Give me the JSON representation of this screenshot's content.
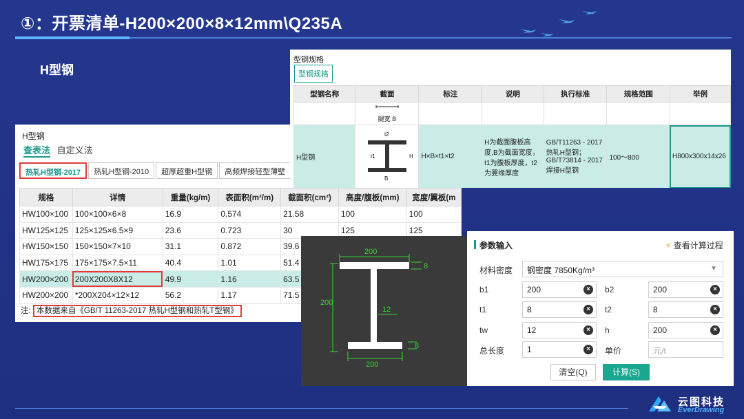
{
  "slide": {
    "title": "①：开票清单-H200×200×8×12mm\\Q235A",
    "section": "H型钢",
    "logo_cn": "云图科技",
    "logo_en": "EverDrawing"
  },
  "lookup": {
    "header": "H型钢",
    "tabs": [
      "查表法",
      "自定义法"
    ],
    "subtabs": [
      "热轧H型钢-2017",
      "热轧H型钢-2010",
      "超厚超重H型钢",
      "高频焊接轻型薄壁"
    ],
    "columns": [
      "规格",
      "详情",
      "重量(kg/m)",
      "表面积(m²/m)",
      "截面积(cm²)",
      "高度/腹板(mm)",
      "宽度/翼板(m"
    ],
    "rows": [
      [
        "HW100×100",
        "100×100×6×8",
        "16.9",
        "0.574",
        "21.58",
        "100",
        "100"
      ],
      [
        "HW125×125",
        "125×125×6.5×9",
        "23.6",
        "0.723",
        "30",
        "125",
        "125"
      ],
      [
        "HW150×150",
        "150×150×7×10",
        "31.1",
        "0.872",
        "39.6",
        "",
        ""
      ],
      [
        "HW175×175",
        "175×175×7.5×11",
        "40.4",
        "1.01",
        "51.4",
        "",
        ""
      ],
      [
        "HW200×200",
        "200X200X8X12",
        "49.9",
        "1.16",
        "63.5",
        "",
        ""
      ],
      [
        "HW200×200",
        "*200X204×12×12",
        "56.2",
        "1.17",
        "71.5",
        "",
        ""
      ]
    ],
    "note_prefix": "注:",
    "note": "本数据来自《GB/T 11263-2017 热轧H型钢和热轧T型钢》"
  },
  "spec": {
    "header": "型钢规格",
    "button": "型钢规格",
    "columns": [
      "型钢名称",
      "截面",
      "标注",
      "说明",
      "执行标准",
      "规格范围",
      "举例"
    ],
    "row": {
      "name": "H型钢",
      "label": "H×B×t1×t2",
      "desc": "H为截面腹板高度,B为截面宽度，t1为腹板厚度，t2为翼缘厚度",
      "standard": "GB/T11263 - 2017 热轧H型钢；GB/T73814 - 2017 焊接H型钢",
      "range": "100～800",
      "example": "H800x300x14x26"
    },
    "cross_section_label": "腿宽 B"
  },
  "diagram": {
    "top_width": "200",
    "bottom_width": "200",
    "height": "200",
    "web": "12",
    "top_flange": "8",
    "bottom_flange": "8"
  },
  "params": {
    "title": "参数输入",
    "view_process": "查看计算过程",
    "density_label": "材料密度",
    "density_value": "钢密度 7850Kg/m³",
    "b1_label": "b1",
    "b1": "200",
    "b2_label": "b2",
    "b2": "200",
    "t1_label": "t1",
    "t1": "8",
    "t2_label": "t2",
    "t2": "8",
    "tw_label": "tw",
    "tw": "12",
    "h_label": "h",
    "h": "200",
    "length_label": "总长度",
    "length": "1",
    "price_label": "单价",
    "price_placeholder": "元/t",
    "clear": "清空(Q)",
    "calc": "计算(S)"
  },
  "colors": {
    "accent": "#1a9a8a",
    "highlight_box": "#e23b3b",
    "dimension": "#39d439"
  }
}
